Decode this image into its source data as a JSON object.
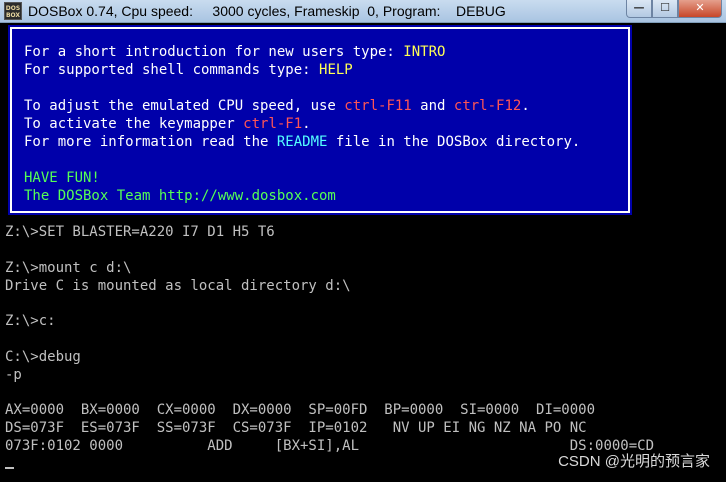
{
  "window": {
    "title": "DOSBox 0.74, Cpu speed:     3000 cycles, Frameskip  0, Program:    DEBUG",
    "icon_text_top": "DOS",
    "icon_text_bottom": "BOX",
    "minimize_glyph": "—",
    "maximize_glyph": "☐",
    "close_glyph": "✕"
  },
  "banner": {
    "line1_prefix": "For a short introduction for new users type: ",
    "line1_cmd": "INTRO",
    "line2_prefix": "For supported shell commands type: ",
    "line2_cmd": "HELP",
    "line3_prefix": "To adjust the emulated CPU speed, use ",
    "line3_key1": "ctrl-F11",
    "line3_mid": " and ",
    "line3_key2": "ctrl-F12",
    "line3_end": ".",
    "line4_prefix": "To activate the keymapper ",
    "line4_key": "ctrl-F1",
    "line4_end": ".",
    "line5_prefix": "For more information read the ",
    "line5_link": "README",
    "line5_end": " file in the DOSBox directory.",
    "have_fun": "HAVE FUN!",
    "team": "The DOSBox Team http://www.dosbox.com"
  },
  "terminal": {
    "lines": [
      "Z:\\>SET BLASTER=A220 I7 D1 H5 T6",
      "",
      "Z:\\>mount c d:\\",
      "Drive C is mounted as local directory d:\\",
      "",
      "Z:\\>c:",
      "",
      "C:\\>debug",
      "-p",
      "",
      "AX=0000  BX=0000  CX=0000  DX=0000  SP=00FD  BP=0000  SI=0000  DI=0000",
      "DS=073F  ES=073F  SS=073F  CS=073F  IP=0102   NV UP EI NG NZ NA PO NC",
      "073F:0102 0000          ADD     [BX+SI],AL                         DS:0000=CD"
    ]
  },
  "watermark": "CSDN @光明的预言家",
  "colors": {
    "banner_bg": "#0000aa",
    "terminal_text": "#c0c0c0",
    "highlight_yellow": "#ffff55",
    "highlight_red": "#ff5555",
    "highlight_cyan": "#55ffff",
    "highlight_green": "#55ff55"
  }
}
